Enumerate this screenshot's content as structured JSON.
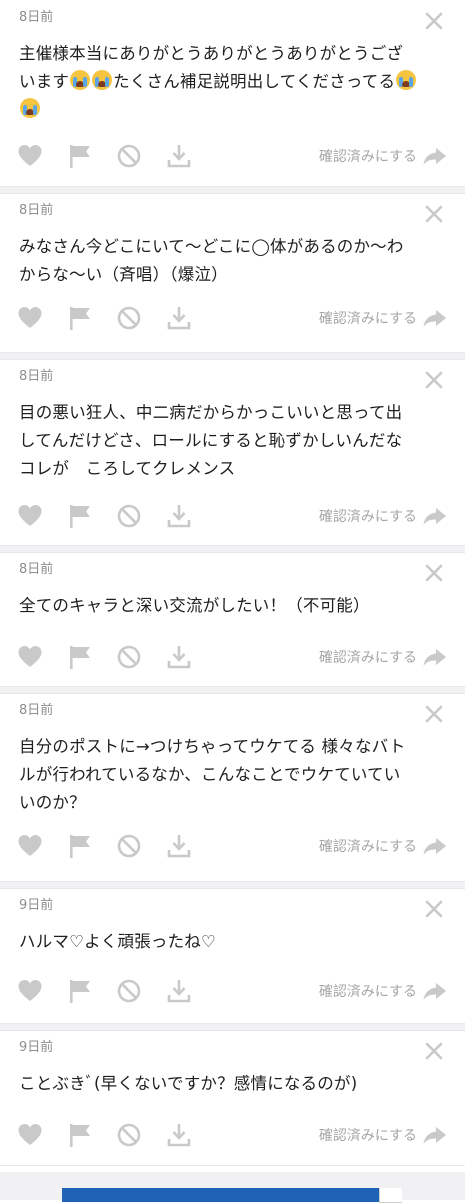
{
  "labels": {
    "confirm": "確認済みにする"
  },
  "colors": {
    "icon": "#c9c9c9",
    "meta_text": "#8e8e8e",
    "ad_blue": "#1f63b6"
  },
  "icons": {
    "close": "close-icon",
    "like": "heart-icon",
    "flag": "flag-icon",
    "block": "block-icon",
    "download": "download-icon",
    "share": "share-arrow-icon"
  },
  "posts": [
    {
      "time": "8日前",
      "lines": [
        [
          {
            "t": "主催様本当にありがとうありがとうありがとうござ"
          }
        ],
        [
          {
            "t": "います"
          },
          {
            "e": "loudly-crying-emoji"
          },
          {
            "e": "loudly-crying-emoji"
          },
          {
            "t": "たくさん補足説明出してくださってる"
          },
          {
            "e": "loudly-crying-emoji"
          }
        ],
        [
          {
            "e": "loudly-crying-emoji"
          }
        ]
      ]
    },
    {
      "time": "8日前",
      "lines": [
        [
          {
            "t": "みなさん今どこにいて〜どこに◯体があるのか〜わ"
          }
        ],
        [
          {
            "t": "からな〜い（斉唱）（爆泣）"
          }
        ]
      ]
    },
    {
      "time": "8日前",
      "lines": [
        [
          {
            "t": "目の悪い狂人、中二病だからかっこいいと思って出"
          }
        ],
        [
          {
            "t": "してんだけどさ、ロールにすると恥ずかしいんだな"
          }
        ],
        [
          {
            "t": "コレが　ころしてクレメンス"
          }
        ]
      ]
    },
    {
      "time": "8日前",
      "lines": [
        [
          {
            "t": "全てのキャラと深い交流がしたい！（不可能）"
          }
        ]
      ]
    },
    {
      "time": "8日前",
      "lines": [
        [
          {
            "t": "自分のポストに→つけちゃってウケてる 様々なバト"
          }
        ],
        [
          {
            "t": "ルが行われているなか、こんなことでウケていてい"
          }
        ],
        [
          {
            "t": "いのか？"
          }
        ]
      ]
    },
    {
      "time": "9日前",
      "lines": [
        [
          {
            "t": "ハルマ♡よく頑張ったね♡"
          }
        ]
      ]
    },
    {
      "time": "9日前",
      "lines": [
        [
          {
            "t": "ことぶきﾞ(早くないですか？感情になるのが)"
          }
        ]
      ]
    }
  ]
}
